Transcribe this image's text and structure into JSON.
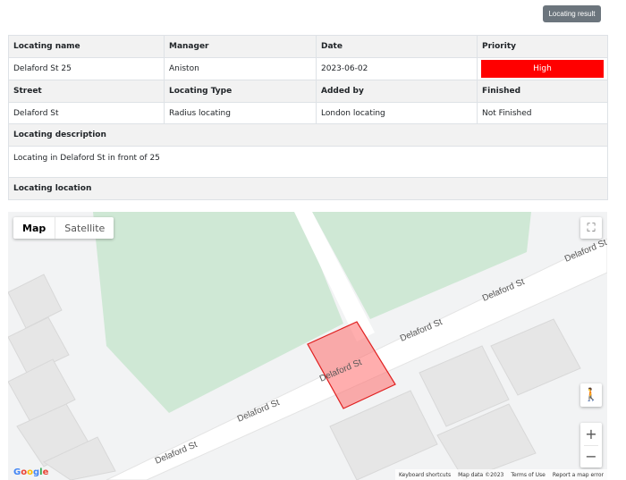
{
  "header": {
    "result_button": "Locating result"
  },
  "table": {
    "row1_headers": [
      "Locating name",
      "Manager",
      "Date",
      "Priority"
    ],
    "row1_values": {
      "name": "Delaford St 25",
      "manager": "Aniston",
      "date": "2023-06-02",
      "priority": "High"
    },
    "row2_headers": [
      "Street",
      "Locating Type",
      "Added by",
      "Finished"
    ],
    "row2_values": {
      "street": "Delaford St",
      "type": "Radius locating",
      "added_by": "London locating",
      "finished": "Not Finished"
    },
    "description_header": "Locating description",
    "description": "Locating in Delaford St in front of 25",
    "location_header": "Locating location"
  },
  "map": {
    "map_type_active": "Map",
    "map_type_other": "Satellite",
    "fullscreen_icon": "⛶",
    "pegman_icon": "🚶",
    "zoom_in": "+",
    "zoom_out": "−",
    "street_labels": [
      "Delaford St",
      "Delaford St",
      "Delaford St",
      "Delaford St",
      "Delaford St",
      "Delaford St"
    ],
    "attribution": {
      "shortcuts": "Keyboard shortcuts",
      "data": "Map data ©2023",
      "terms": "Terms of Use",
      "report": "Report a map error"
    },
    "colors": {
      "park": "#cfe8d5",
      "road": "#ffffff",
      "building": "#e8e8e8",
      "polygon_fill": "#ff6b6b",
      "polygon_stroke": "#e02020"
    }
  }
}
